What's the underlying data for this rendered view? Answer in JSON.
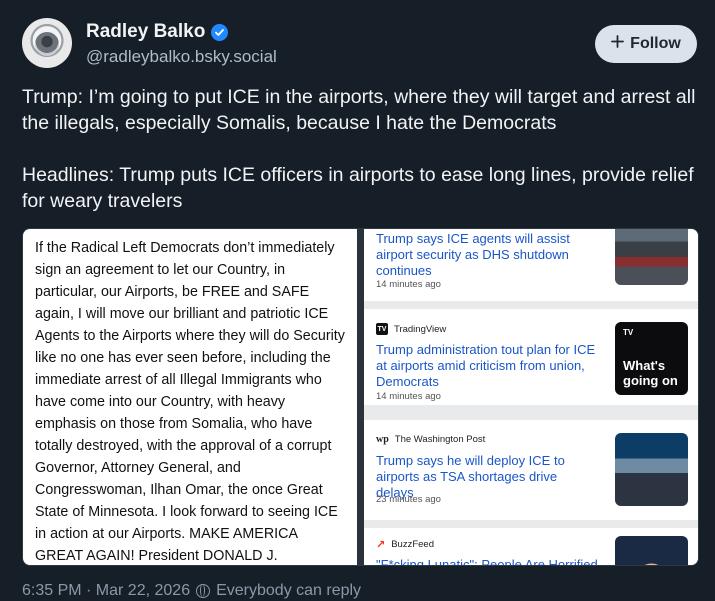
{
  "author": {
    "display_name": "Radley Balko",
    "handle": "@radleybalko.bsky.social",
    "verified_icon": "verified-check-icon",
    "avatar_text": "ILLE CHICAGO"
  },
  "follow_button": {
    "label": "Follow",
    "icon": "plus-icon"
  },
  "post": {
    "text": "Trump: I’m going to put ICE in the airports, where they will target and arrest all the illegals, especially Somalis, because I hate the Democrats\n\nHeadlines: Trump puts ICE officers in airports to ease long lines, provide relief for weary travelers"
  },
  "media": {
    "statement": "If the Radical Left Democrats don’t immediately sign an agreement to let our Country, in particular, our Airports, be FREE and SAFE again, I will move our brilliant and patriotic ICE Agents to the Airports where they will do Security like no one has ever seen before, including the immediate arrest of all Illegal Immigrants who have come into our Country, with heavy emphasis on those from Somalia, who have totally destroyed, with the approval of a corrupt Governor, Attorney General, and Congresswoman, Ilhan Omar, the once Great State of Minnesota. I look forward to seeing ICE in action at our Airports. MAKE AMERICA GREAT AGAIN! President DONALD J.",
    "news": [
      {
        "source": "",
        "headline": "Trump says ICE agents will assist airport security as DHS shutdown continues",
        "time": "14 minutes ago"
      },
      {
        "source": "TradingView",
        "source_logo": "TV",
        "headline": "Trump administration tout plan for ICE at airports amid criticism from union, Democrats",
        "time": "14 minutes ago",
        "thumb_text": "What's going on",
        "thumb_logo": "TV"
      },
      {
        "source": "The Washington Post",
        "source_logo": "wp",
        "headline": "Trump says he will deploy ICE to airports as TSA shortages drive delays",
        "time": "23 minutes ago"
      },
      {
        "source": "BuzzFeed",
        "source_logo": "↗",
        "headline": "\"F*cking Lunatic\": People Are Horrified",
        "time": ""
      }
    ]
  },
  "footer": {
    "timestamp": "6:35 PM · Mar 22, 2026",
    "reply_setting": "Everybody can reply",
    "reply_icon": "globe-icon"
  },
  "colors": {
    "background": "#161e27",
    "link_blue": "#1a56c8",
    "verified_blue": "#208bfe",
    "follow_bg": "#dce2ea"
  }
}
